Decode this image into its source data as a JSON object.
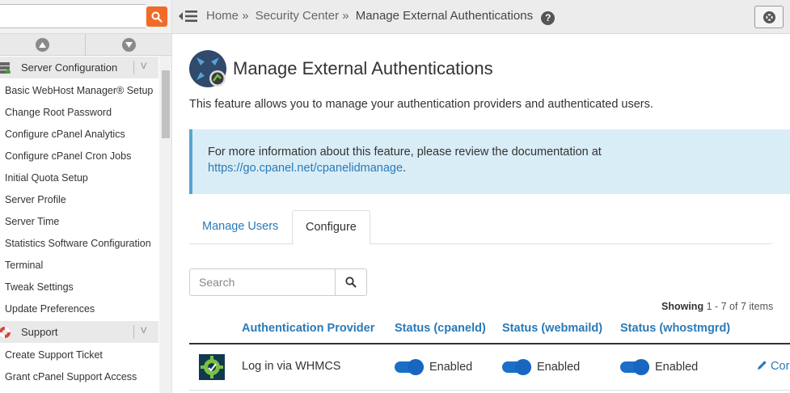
{
  "sidebar": {
    "search_placeholder": "",
    "groups": [
      {
        "title": "Server Configuration",
        "items": [
          "Basic WebHost Manager® Setup",
          "Change Root Password",
          "Configure cPanel Analytics",
          "Configure cPanel Cron Jobs",
          "Initial Quota Setup",
          "Server Profile",
          "Server Time",
          "Statistics Software Configuration",
          "Terminal",
          "Tweak Settings",
          "Update Preferences"
        ]
      },
      {
        "title": "Support",
        "items": [
          "Create Support Ticket",
          "Grant cPanel Support Access"
        ]
      }
    ],
    "collapse_glyph": "V"
  },
  "topbar": {
    "breadcrumb": {
      "home": "Home",
      "sep": "»",
      "section": "Security Center",
      "current": "Manage External Authentications"
    },
    "help_glyph": "?"
  },
  "main": {
    "title": "Manage External Authentications",
    "description": "This feature allows you to manage your authentication providers and authenticated users.",
    "info": {
      "line1": "For more information about this feature, please review the documentation at",
      "link": "https://go.cpanel.net/cpanelidmanage",
      "suffix": "."
    },
    "tabs": [
      "Manage Users",
      "Configure"
    ],
    "search_placeholder": "Search",
    "showing": {
      "label": "Showing",
      "range": "1 - 7 of 7 items"
    },
    "table": {
      "headers": [
        "Authentication Provider",
        "Status (cpaneld)",
        "Status (webmaild)",
        "Status (whostmgrd)"
      ],
      "rows": [
        {
          "provider": "Log in via WHMCS",
          "status_cpaneld": "Enabled",
          "status_webmaild": "Enabled",
          "status_whostmgrd": "Enabled",
          "action": "Cor"
        }
      ]
    }
  },
  "colors": {
    "accent_orange": "#f06b28",
    "link_blue": "#2a7ab8",
    "info_bg": "#d9edf7",
    "toggle_blue": "#1b6fc7"
  }
}
